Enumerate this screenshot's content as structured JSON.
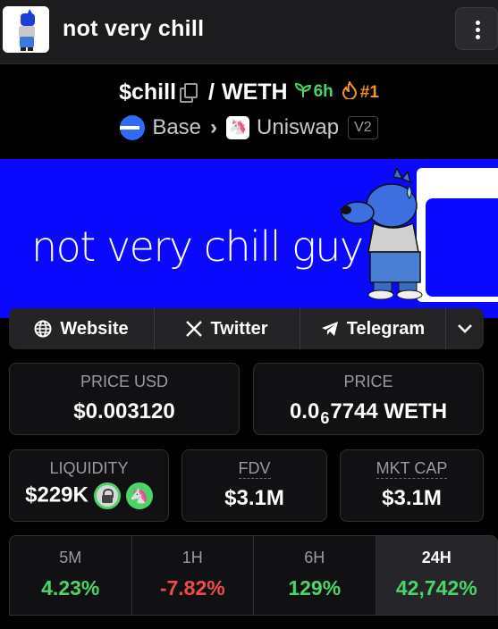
{
  "header": {
    "title": "not very chill",
    "menu_icon": "more-vertical-icon"
  },
  "pair": {
    "base": "$chill",
    "quote": "WETH",
    "age": "6h",
    "rank": "#1",
    "age_icon": "seedling-icon",
    "rank_icon": "flame-icon"
  },
  "chain": {
    "network": "Base",
    "dex": "Uniswap",
    "version": "V2"
  },
  "banner": {
    "text": "not very chill guy"
  },
  "links": {
    "website": "Website",
    "twitter": "Twitter",
    "telegram": "Telegram"
  },
  "stats": {
    "price_usd_label": "PRICE USD",
    "price_usd_value": "$0.003120",
    "price_label": "PRICE",
    "price_prefix": "0.0",
    "price_zeros": "6",
    "price_digits": "7744",
    "price_unit": "WETH",
    "liquidity_label": "LIQUIDITY",
    "liquidity_value": "$229K",
    "fdv_label": "FDV",
    "fdv_value": "$3.1M",
    "mktcap_label": "MKT CAP",
    "mktcap_value": "$3.1M"
  },
  "timeframes": [
    {
      "label": "5M",
      "value": "4.23%"
    },
    {
      "label": "1H",
      "value": "-7.82%"
    },
    {
      "label": "6H",
      "value": "129%"
    },
    {
      "label": "24H",
      "value": "42,742%"
    }
  ],
  "colors": {
    "positive": "#4bd568",
    "negative": "#f04b4b",
    "rank": "#f7931a",
    "banner": "#0a08ff"
  }
}
